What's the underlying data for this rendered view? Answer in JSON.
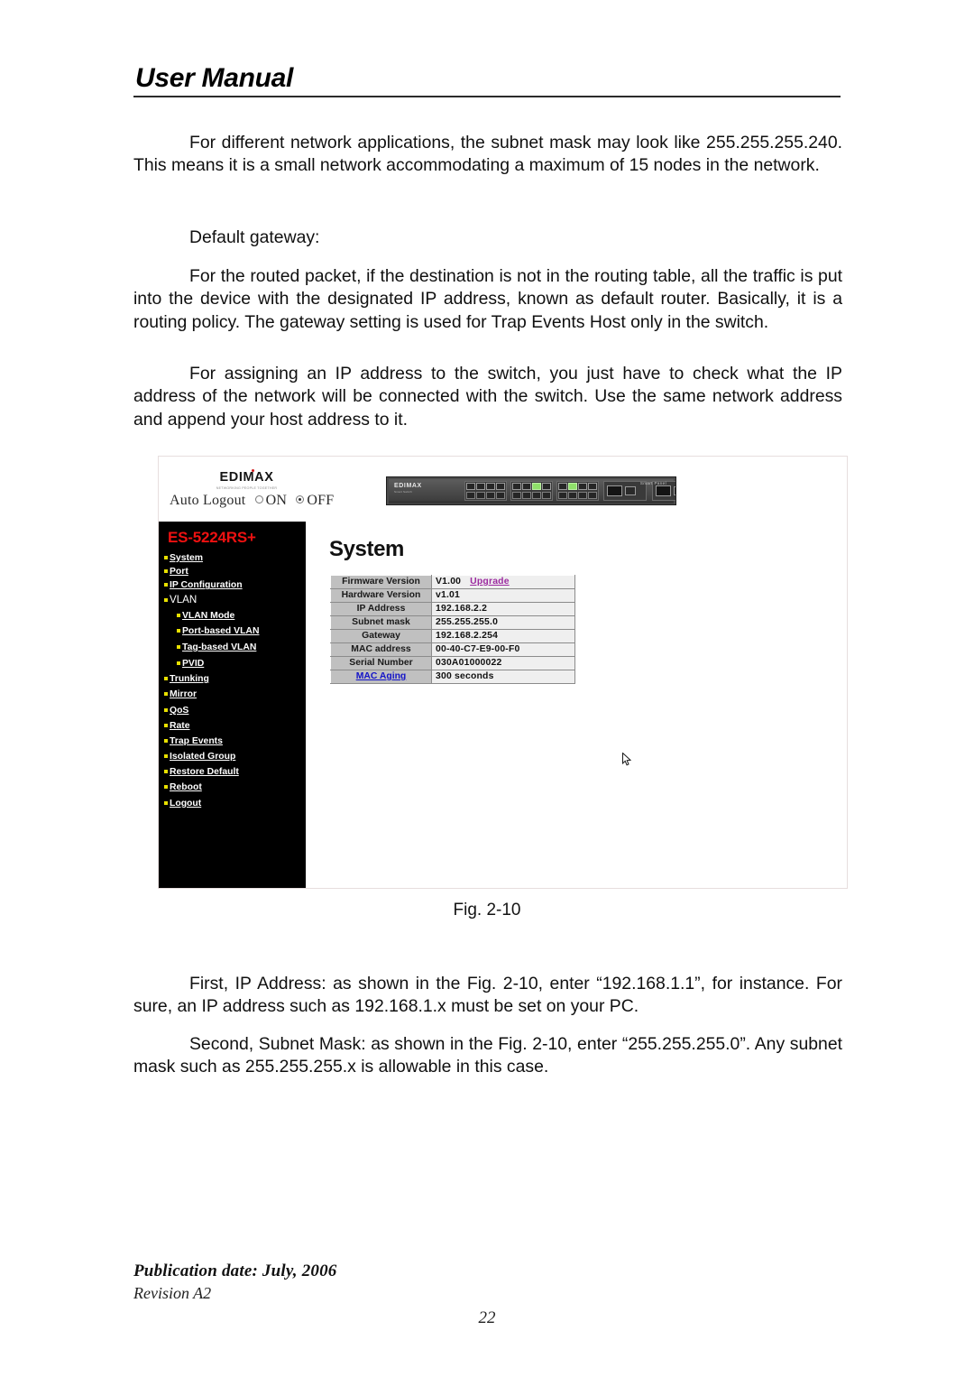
{
  "header": {
    "title": "User Manual"
  },
  "body": {
    "p1": "For different network applications, the subnet mask may look like 255.255.255.240. This means it is a small network accommodating a maximum of 15 nodes in the network.",
    "p2": "Default gateway:",
    "p3": "For the routed packet, if the destination is not in the routing table, all the traffic is put into the device with the designated IP address, known as default router. Basically, it is a routing policy. The gateway setting is used for Trap Events Host only in the switch.",
    "p4": "For assigning an IP address to the switch, you just have to check what the IP address of the network will be connected with the switch. Use the same network address and append your host address to it.",
    "p5": "First, IP Address: as shown in the Fig. 2-10, enter “192.168.1.1”, for instance. For sure, an IP address such as 192.168.1.x must be set on your PC.",
    "p6": "Second, Subnet Mask: as shown in the Fig. 2-10, enter “255.255.255.0”.  Any subnet mask such as 255.255.255.x is allowable in this case."
  },
  "figure": {
    "caption": "Fig. 2-10",
    "brand": {
      "name": "EDIMAX",
      "tagline": "NETWORKING PEOPLE TOGETHER"
    },
    "auto_logout": {
      "label": "Auto Logout",
      "option_on": "ON",
      "option_off": "OFF",
      "selected": "OFF"
    },
    "device_photo": {
      "brand": "EDIMAX",
      "brand_sub": "Smart Switch",
      "panel_label": "Smart Panel"
    },
    "sidebar": {
      "model": "ES-5224RS+",
      "items": [
        {
          "label": "System",
          "level": 0,
          "link": true
        },
        {
          "label": "Port",
          "level": 0,
          "link": true
        },
        {
          "label": "IP Configuration",
          "level": 0,
          "link": true
        },
        {
          "label": "VLAN",
          "level": 0,
          "link": false
        },
        {
          "label": "VLAN Mode",
          "level": 1,
          "link": true
        },
        {
          "label": "Port-based VLAN",
          "level": 1,
          "link": true
        },
        {
          "label": "Tag-based VLAN",
          "level": 1,
          "link": true
        },
        {
          "label": "PVID",
          "level": 1,
          "link": true
        },
        {
          "label": "Trunking",
          "level": 0,
          "link": true
        },
        {
          "label": "Mirror",
          "level": 0,
          "link": true
        },
        {
          "label": "QoS",
          "level": 0,
          "link": true
        },
        {
          "label": "Rate",
          "level": 0,
          "link": true
        },
        {
          "label": "Trap Events",
          "level": 0,
          "link": true
        },
        {
          "label": "Isolated Group",
          "level": 0,
          "link": true
        },
        {
          "label": "Restore Default",
          "level": 0,
          "link": true
        },
        {
          "label": "Reboot",
          "level": 0,
          "link": true
        },
        {
          "label": "Logout",
          "level": 0,
          "link": true
        }
      ]
    },
    "page_title": "System",
    "system_table": {
      "rows": [
        {
          "key": "Firmware Version",
          "value": "V1.00",
          "link": "Upgrade",
          "key_link": false
        },
        {
          "key": "Hardware Version",
          "value": "v1.01",
          "link": "",
          "key_link": false
        },
        {
          "key": "IP Address",
          "value": "192.168.2.2",
          "link": "",
          "key_link": false
        },
        {
          "key": "Subnet mask",
          "value": "255.255.255.0",
          "link": "",
          "key_link": false
        },
        {
          "key": "Gateway",
          "value": "192.168.2.254",
          "link": "",
          "key_link": false
        },
        {
          "key": "MAC address",
          "value": "00-40-C7-E9-00-F0",
          "link": "",
          "key_link": false
        },
        {
          "key": "Serial Number",
          "value": "030A01000022",
          "link": "",
          "key_link": false
        },
        {
          "key": "MAC Aging",
          "value": "300 seconds",
          "link": "",
          "key_link": true
        }
      ]
    },
    "colors": {
      "model_red": "#ee1111",
      "bullet_yellow": "#e8e000",
      "link_purple": "#9c2ba0",
      "link_blue": "#1414c8",
      "sidebar_black": "#000000",
      "table_key_gray": "#c0c0c0",
      "table_value_gray": "#efefef"
    }
  },
  "footer": {
    "publication_date": "Publication date: July, 2006",
    "revision": "Revision A2",
    "page_number": "22"
  }
}
